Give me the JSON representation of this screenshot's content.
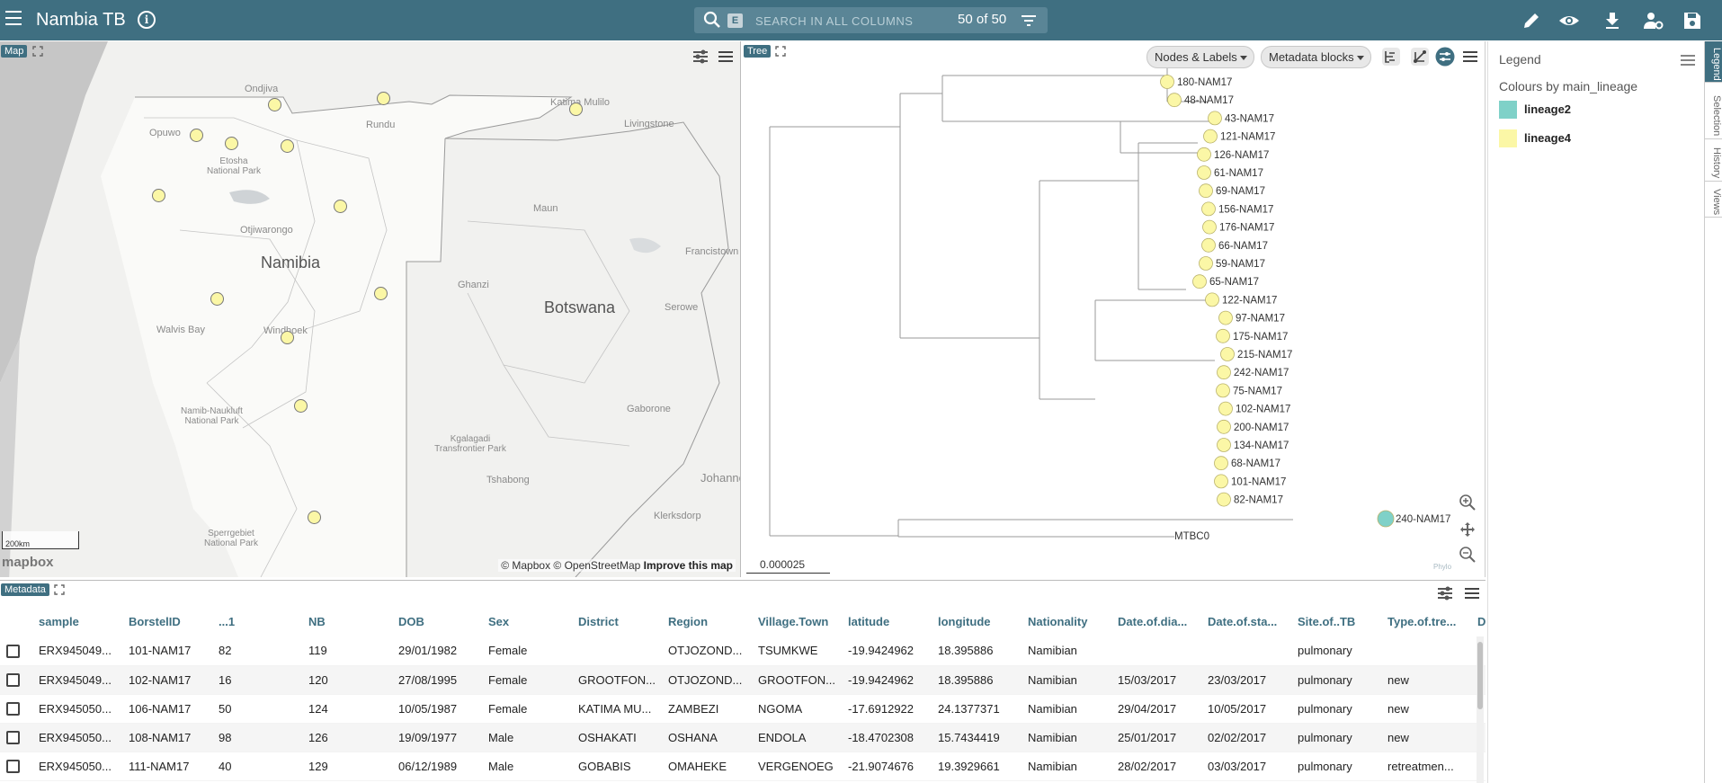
{
  "header": {
    "title": "Nambia TB",
    "search_key": "E",
    "search_placeholder": "SEARCH IN ALL COLUMNS",
    "row_count": "50 of 50",
    "brand_color": "#3f6f81",
    "icons": [
      "menu-icon",
      "info-icon",
      "search-icon",
      "filter-icon",
      "pencil-icon",
      "eye-icon",
      "download-icon",
      "account-settings-icon",
      "save-icon"
    ]
  },
  "map": {
    "tag": "Map",
    "country_labels": [
      "Namibia",
      "Botswana"
    ],
    "place_labels": [
      "Ondjiva",
      "Opuwo",
      "Rundu",
      "Katima Mulilo",
      "Livingstone",
      "Etosha National Park",
      "Otjiwarongo",
      "Maun",
      "Francistown",
      "Ghanzi",
      "Walvis Bay",
      "Windhoek",
      "Serowe",
      "Namib-Naukluft National Park",
      "Gaborone",
      "Kgalagadi Transfrontier Park",
      "Tshabong",
      "Johanne",
      "Klerksdorp",
      "Sperrgebiet National Park"
    ],
    "scale": "200km",
    "logo": "mapbox",
    "attribution": "© Mapbox © OpenStreetMap",
    "improve_link": "Improve this map",
    "marker_color": "#fbf7a6"
  },
  "tree": {
    "tag": "Tree",
    "nodes_labels_btn": "Nodes & Labels",
    "metadata_blocks_btn": "Metadata blocks",
    "leaves": [
      {
        "label": "180-NAM17",
        "lineage": "lineage4"
      },
      {
        "label": "48-NAM17",
        "lineage": "lineage4"
      },
      {
        "label": "43-NAM17",
        "lineage": "lineage4"
      },
      {
        "label": "121-NAM17",
        "lineage": "lineage4"
      },
      {
        "label": "126-NAM17",
        "lineage": "lineage4"
      },
      {
        "label": "61-NAM17",
        "lineage": "lineage4"
      },
      {
        "label": "69-NAM17",
        "lineage": "lineage4"
      },
      {
        "label": "156-NAM17",
        "lineage": "lineage4"
      },
      {
        "label": "176-NAM17",
        "lineage": "lineage4"
      },
      {
        "label": "66-NAM17",
        "lineage": "lineage4"
      },
      {
        "label": "59-NAM17",
        "lineage": "lineage4"
      },
      {
        "label": "65-NAM17",
        "lineage": "lineage4"
      },
      {
        "label": "122-NAM17",
        "lineage": "lineage4"
      },
      {
        "label": "97-NAM17",
        "lineage": "lineage4"
      },
      {
        "label": "175-NAM17",
        "lineage": "lineage4"
      },
      {
        "label": "215-NAM17",
        "lineage": "lineage4"
      },
      {
        "label": "242-NAM17",
        "lineage": "lineage4"
      },
      {
        "label": "75-NAM17",
        "lineage": "lineage4"
      },
      {
        "label": "102-NAM17",
        "lineage": "lineage4"
      },
      {
        "label": "200-NAM17",
        "lineage": "lineage4"
      },
      {
        "label": "134-NAM17",
        "lineage": "lineage4"
      },
      {
        "label": "68-NAM17",
        "lineage": "lineage4"
      },
      {
        "label": "101-NAM17",
        "lineage": "lineage4"
      },
      {
        "label": "82-NAM17",
        "lineage": "lineage4"
      },
      {
        "label": "240-NAM17",
        "lineage": "lineage2"
      },
      {
        "label": "MTBC0",
        "lineage": ""
      }
    ],
    "scale_label": "0.000025",
    "watermark": "Phylo"
  },
  "legend": {
    "title": "Legend",
    "subtitle": "Colours by main_lineage",
    "items": [
      {
        "label": "lineage2",
        "color": "#7fd1c8"
      },
      {
        "label": "lineage4",
        "color": "#fbf7a6"
      }
    ]
  },
  "side_tabs": [
    "Legend",
    "Selection",
    "History",
    "Views"
  ],
  "metadata": {
    "tag": "Metadata",
    "columns": [
      "sample",
      "BorstelID",
      "...1",
      "NB",
      "DOB",
      "Sex",
      "District",
      "Region",
      "Village.Town",
      "latitude",
      "longitude",
      "Nationality",
      "Date.of.dia...",
      "Date.of.sta...",
      "Site.of..TB",
      "Type.of.tre...",
      "D"
    ],
    "rows": [
      [
        "ERX945049...",
        "101-NAM17",
        "82",
        "119",
        "29/01/1982",
        "Female",
        "",
        "OTJOZOND...",
        "TSUMKWE",
        "-19.9424962",
        "18.395886",
        "Namibian",
        "",
        "",
        "pulmonary",
        "",
        ""
      ],
      [
        "ERX945049...",
        "102-NAM17",
        "16",
        "120",
        "27/08/1995",
        "Female",
        "GROOTFON...",
        "OTJOZOND...",
        "GROOTFON...",
        "-19.9424962",
        "18.395886",
        "Namibian",
        "15/03/2017",
        "23/03/2017",
        "pulmonary",
        "new",
        ""
      ],
      [
        "ERX945050...",
        "106-NAM17",
        "50",
        "124",
        "10/05/1987",
        "Female",
        "KATIMA MU...",
        "ZAMBEZI",
        "NGOMA",
        "-17.6912922",
        "24.1377371",
        "Namibian",
        "29/04/2017",
        "10/05/2017",
        "pulmonary",
        "new",
        ""
      ],
      [
        "ERX945050...",
        "108-NAM17",
        "98",
        "126",
        "19/09/1977",
        "Male",
        "OSHAKATI",
        "OSHANA",
        "ENDOLA",
        "-18.4702308",
        "15.7434419",
        "Namibian",
        "25/01/2017",
        "02/02/2017",
        "pulmonary",
        "new",
        ""
      ],
      [
        "ERX945050...",
        "111-NAM17",
        "40",
        "129",
        "06/12/1989",
        "Male",
        "GOBABIS",
        "OMAHEKE",
        "VERGENOEG",
        "-21.9074676",
        "19.3929661",
        "Namibian",
        "28/02/2017",
        "03/03/2017",
        "pulmonary",
        "retreatmen...",
        ""
      ]
    ]
  }
}
